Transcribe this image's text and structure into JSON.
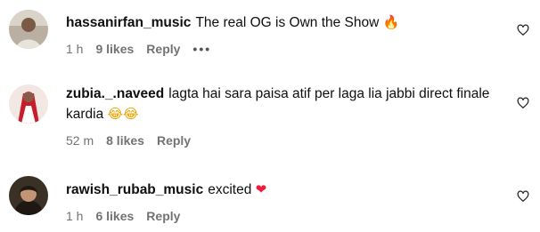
{
  "comments": [
    {
      "username": "hassanirfan_music",
      "text": "The real OG is Own the Show",
      "emoji": "🔥",
      "time": "1 h",
      "likes": "9 likes",
      "reply": "Reply",
      "more": "•••"
    },
    {
      "username": "zubia._.naveed",
      "text": "lagta hai sara paisa atif per laga lia jabbi direct finale kardia",
      "emoji": "😂😂",
      "time": "52 m",
      "likes": "8 likes",
      "reply": "Reply"
    },
    {
      "username": "rawish_rubab_music",
      "text": "excited",
      "emoji": "❤",
      "time": "1 h",
      "likes": "6 likes",
      "reply": "Reply"
    }
  ],
  "colors": {
    "text": "#0f0f0f",
    "meta": "#737373",
    "heart_red": "#ed1c3c",
    "fire": "#f5821f"
  }
}
